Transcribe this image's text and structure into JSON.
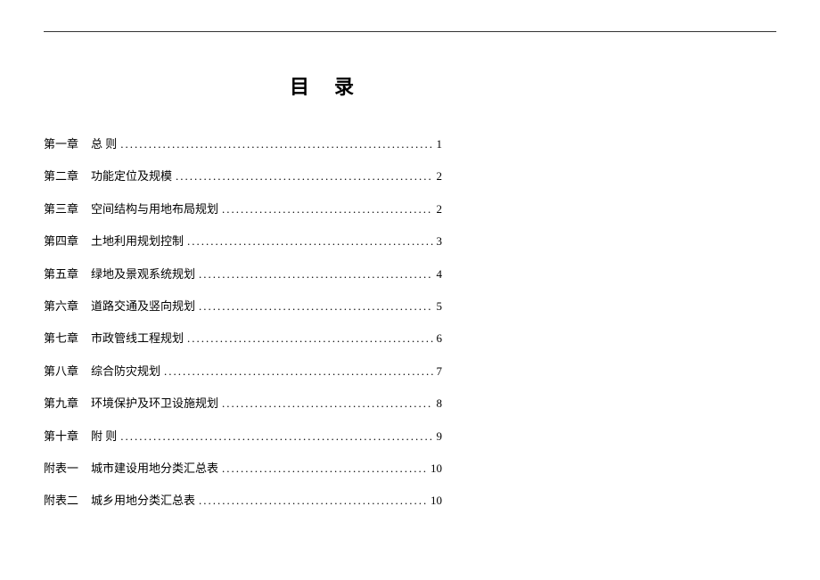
{
  "title": "目录",
  "entries": [
    {
      "chapter": "第一章",
      "label": "总  则",
      "page": "1"
    },
    {
      "chapter": "第二章",
      "label": "功能定位及规模",
      "page": "2"
    },
    {
      "chapter": "第三章",
      "label": "空间结构与用地布局规划",
      "page": "2"
    },
    {
      "chapter": "第四章",
      "label": "土地利用规划控制",
      "page": "3"
    },
    {
      "chapter": "第五章",
      "label": "绿地及景观系统规划",
      "page": "4"
    },
    {
      "chapter": "第六章",
      "label": "道路交通及竖向规划",
      "page": "5"
    },
    {
      "chapter": "第七章",
      "label": "市政管线工程规划",
      "page": "6"
    },
    {
      "chapter": "第八章",
      "label": "综合防灾规划",
      "page": "7"
    },
    {
      "chapter": "第九章",
      "label": "环境保护及环卫设施规划",
      "page": "8"
    },
    {
      "chapter": "第十章",
      "label": "附  则",
      "page": "9"
    },
    {
      "chapter": "附表一",
      "label": "城市建设用地分类汇总表",
      "page": "10"
    },
    {
      "chapter": "附表二",
      "label": "城乡用地分类汇总表",
      "page": "10"
    }
  ]
}
